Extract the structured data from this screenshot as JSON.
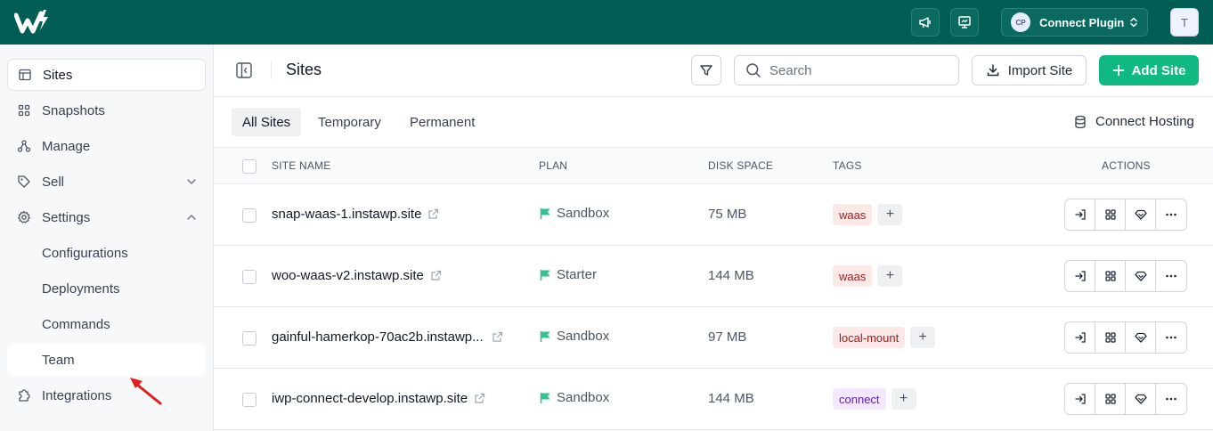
{
  "topbar": {
    "plugin_badge": "CP",
    "plugin_label": "Connect Plugin",
    "avatar_initial": "T",
    "icons": [
      "megaphone-icon",
      "presentation-icon",
      "chevron-updown-icon"
    ]
  },
  "sidebar": {
    "items": [
      {
        "label": "Sites",
        "icon": "layout-icon"
      },
      {
        "label": "Snapshots",
        "icon": "grid-icon"
      },
      {
        "label": "Manage",
        "icon": "network-icon"
      },
      {
        "label": "Sell",
        "icon": "tag-icon"
      },
      {
        "label": "Settings",
        "icon": "gear-icon"
      },
      {
        "label": "Configurations"
      },
      {
        "label": "Deployments"
      },
      {
        "label": "Commands"
      },
      {
        "label": "Team"
      },
      {
        "label": "Integrations",
        "icon": "puzzle-icon"
      }
    ]
  },
  "header": {
    "title": "Sites",
    "search_placeholder": "Search",
    "import_label": "Import Site",
    "add_label": "Add Site"
  },
  "tabs": {
    "all": "All Sites",
    "temporary": "Temporary",
    "permanent": "Permanent",
    "connect_hosting": "Connect Hosting"
  },
  "table": {
    "columns": {
      "name": "SITE NAME",
      "plan": "PLAN",
      "disk": "DISK SPACE",
      "tags": "TAGS",
      "actions": "ACTIONS"
    },
    "rows": [
      {
        "name": "snap-waas-1.instawp.site",
        "plan": "Sandbox",
        "disk": "75 MB",
        "tag": "waas",
        "tag_color": "#fde8e8"
      },
      {
        "name": "woo-waas-v2.instawp.site",
        "plan": "Starter",
        "disk": "144 MB",
        "tag": "waas",
        "tag_color": "#fde8e8"
      },
      {
        "name": "gainful-hamerkop-70ac2b.instawp...",
        "plan": "Sandbox",
        "disk": "97 MB",
        "tag": "local-mount",
        "tag_color": "#fde8e8"
      },
      {
        "name": "iwp-connect-develop.instawp.site",
        "plan": "Sandbox",
        "disk": "144 MB",
        "tag": "connect",
        "tag_color": "#f3e8ff"
      }
    ],
    "tag_add": "+"
  },
  "colors": {
    "topbar": "#005e54",
    "primary": "#10b981",
    "plan_flag": "#34c38f"
  }
}
